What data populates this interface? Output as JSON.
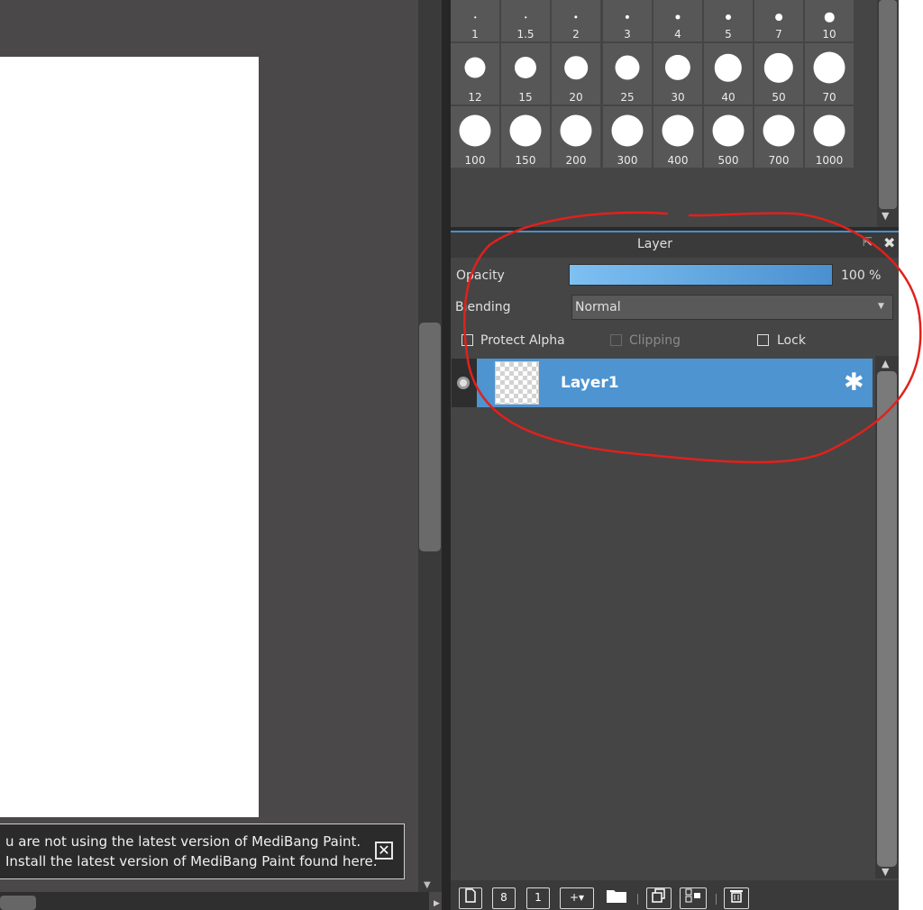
{
  "notice": {
    "line1": "u are not using the latest version of MediBang Paint.",
    "line2": "Install the latest version of MediBang Paint found here.",
    "close_glyph": "✕"
  },
  "brush_sizes": {
    "row1": [
      "1",
      "1.5",
      "2",
      "3",
      "4",
      "5",
      "7",
      "10"
    ],
    "row2": [
      "12",
      "15",
      "20",
      "25",
      "30",
      "40",
      "50",
      "70"
    ],
    "row3": [
      "100",
      "150",
      "200",
      "300",
      "400",
      "500",
      "700",
      "1000"
    ]
  },
  "layer_panel": {
    "title": "Layer",
    "opacity_label": "Opacity",
    "opacity_value": "100 %",
    "opacity_fraction": 1.0,
    "blending_label": "Blending",
    "blending_value": "Normal",
    "protect_alpha_label": "Protect Alpha",
    "clipping_label": "Clipping",
    "lock_label": "Lock",
    "layers": [
      {
        "name": "Layer1",
        "visible": true,
        "selected": true
      }
    ]
  },
  "icons": {
    "gear": "✱",
    "close": "✖",
    "undock": "⇱",
    "dropdown": "▼",
    "scroll_up": "▲",
    "scroll_down": "▼"
  },
  "toolbar": {
    "buttons": [
      "new-layer-icon",
      "new-8bit-layer-icon",
      "new-1bit-layer-icon",
      "add-layer-menu-icon",
      "folder-icon",
      "duplicate-layer-icon",
      "merge-down-icon",
      "delete-layer-icon"
    ]
  },
  "colors": {
    "accent": "#4d94d1",
    "annotation": "#e0211c"
  }
}
